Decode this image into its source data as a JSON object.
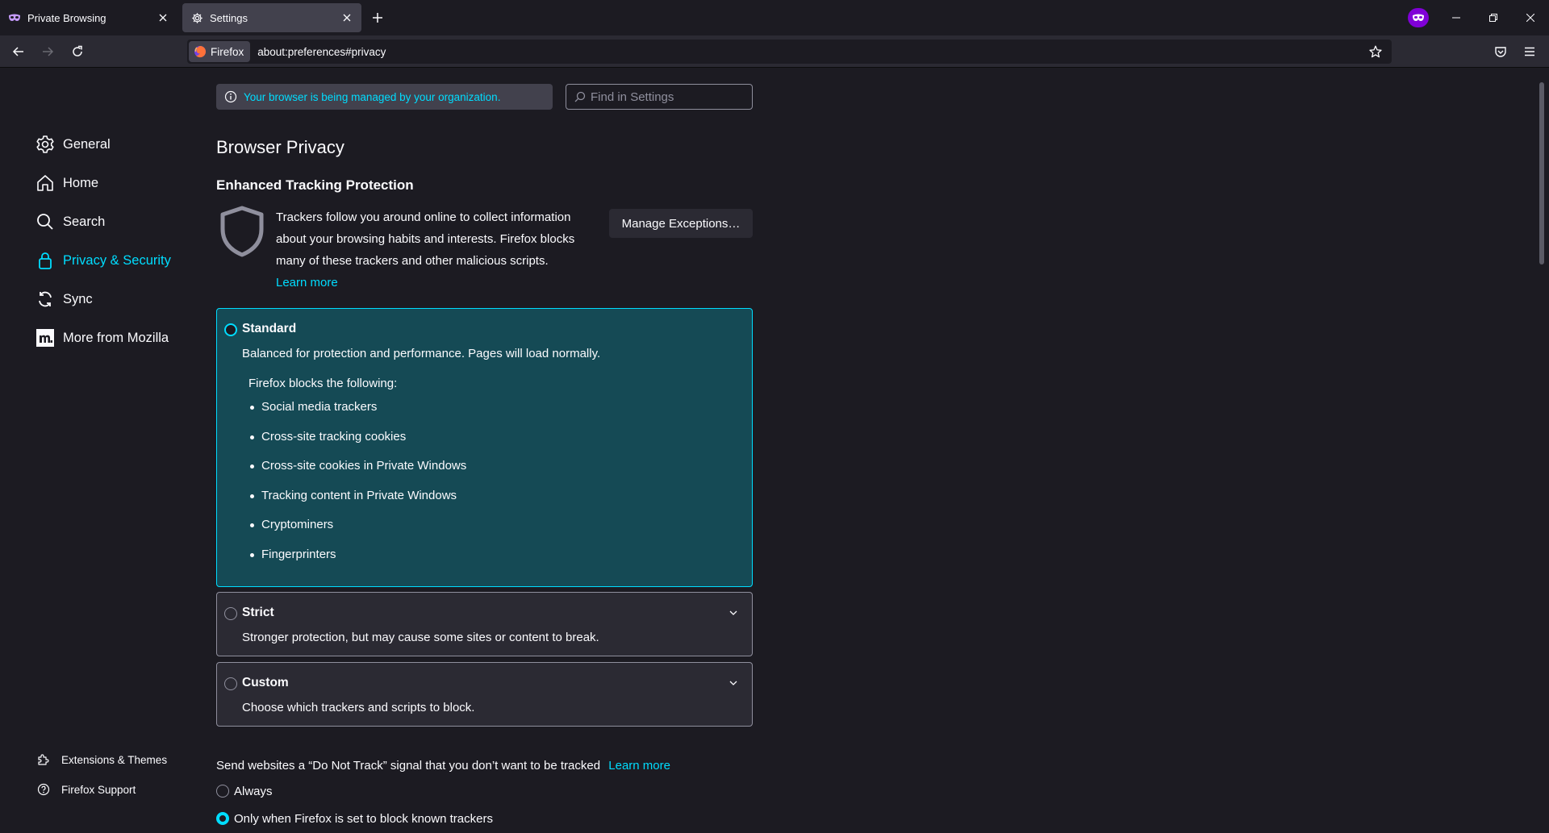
{
  "tabs": [
    {
      "title": "Private Browsing",
      "icon": "private-mask-icon"
    },
    {
      "title": "Settings",
      "icon": "gear-icon",
      "active": true
    }
  ],
  "address": {
    "identity_label": "Firefox",
    "url": "about:preferences#privacy"
  },
  "sidebar": {
    "categories": [
      {
        "label": "General",
        "icon": "gear-icon"
      },
      {
        "label": "Home",
        "icon": "home-icon"
      },
      {
        "label": "Search",
        "icon": "search-icon"
      },
      {
        "label": "Privacy & Security",
        "icon": "lock-icon",
        "selected": true
      },
      {
        "label": "Sync",
        "icon": "sync-icon"
      },
      {
        "label": "More from Mozilla",
        "icon": "mozilla-icon"
      }
    ],
    "footer": [
      {
        "label": "Extensions & Themes",
        "icon": "puzzle-icon"
      },
      {
        "label": "Firefox Support",
        "icon": "help-icon"
      }
    ]
  },
  "main": {
    "policy_notice": "Your browser is being managed by your organization.",
    "search_placeholder": "Find in Settings",
    "page_title": "Browser Privacy",
    "etp": {
      "heading": "Enhanced Tracking Protection",
      "description": "Trackers follow you around online to collect information about your browsing habits and interests. Firefox blocks many of these trackers and other malicious scripts.",
      "learn_more": "Learn more",
      "manage_button": "Manage Exceptions…"
    },
    "options": [
      {
        "title": "Standard",
        "description": "Balanced for protection and performance. Pages will load normally.",
        "selected": true,
        "blocks_heading": "Firefox blocks the following:",
        "blocks": [
          "Social media trackers",
          "Cross-site tracking cookies",
          "Cross-site cookies in Private Windows",
          "Tracking content in Private Windows",
          "Cryptominers",
          "Fingerprinters"
        ]
      },
      {
        "title": "Strict",
        "description": "Stronger protection, but may cause some sites or content to break.",
        "selected": false
      },
      {
        "title": "Custom",
        "description": "Choose which trackers and scripts to block.",
        "selected": false
      }
    ],
    "dnt": {
      "text": "Send websites a “Do Not Track” signal that you don’t want to be tracked",
      "learn_more": "Learn more",
      "options": [
        {
          "label": "Always",
          "selected": false
        },
        {
          "label": "Only when Firefox is set to block known trackers",
          "selected": true
        }
      ]
    }
  },
  "colors": {
    "accent": "#00ddff",
    "background": "#1c1b22",
    "toolbar": "#2b2a33",
    "selected_card": "#154a55",
    "private_badge": "#8000d7"
  }
}
